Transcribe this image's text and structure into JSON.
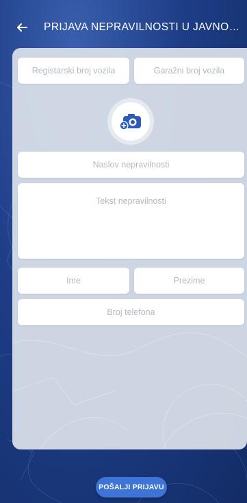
{
  "header": {
    "title": "PRIJAVA NEPRAVILNOSTI U JAVNOM PRE...",
    "back_icon": "arrow-left-icon"
  },
  "form": {
    "registration_placeholder": "Registarski broj vozila",
    "garage_placeholder": "Garažni broj vozila",
    "photo_icon": "add-camera-icon",
    "subject_placeholder": "Naslov nepravilnosti",
    "text_placeholder": "Tekst nepravilnosti",
    "first_name_placeholder": "Ime",
    "last_name_placeholder": "Prezime",
    "phone_placeholder": "Broj telefona"
  },
  "actions": {
    "submit_label": "POŠALJI PRIJAVU"
  },
  "colors": {
    "background": "#1d3d86",
    "card": "#d9dfe9",
    "accent": "#3d74d6",
    "camera_icon": "#2e5bb5",
    "placeholder_text": "#b4b9c1"
  }
}
